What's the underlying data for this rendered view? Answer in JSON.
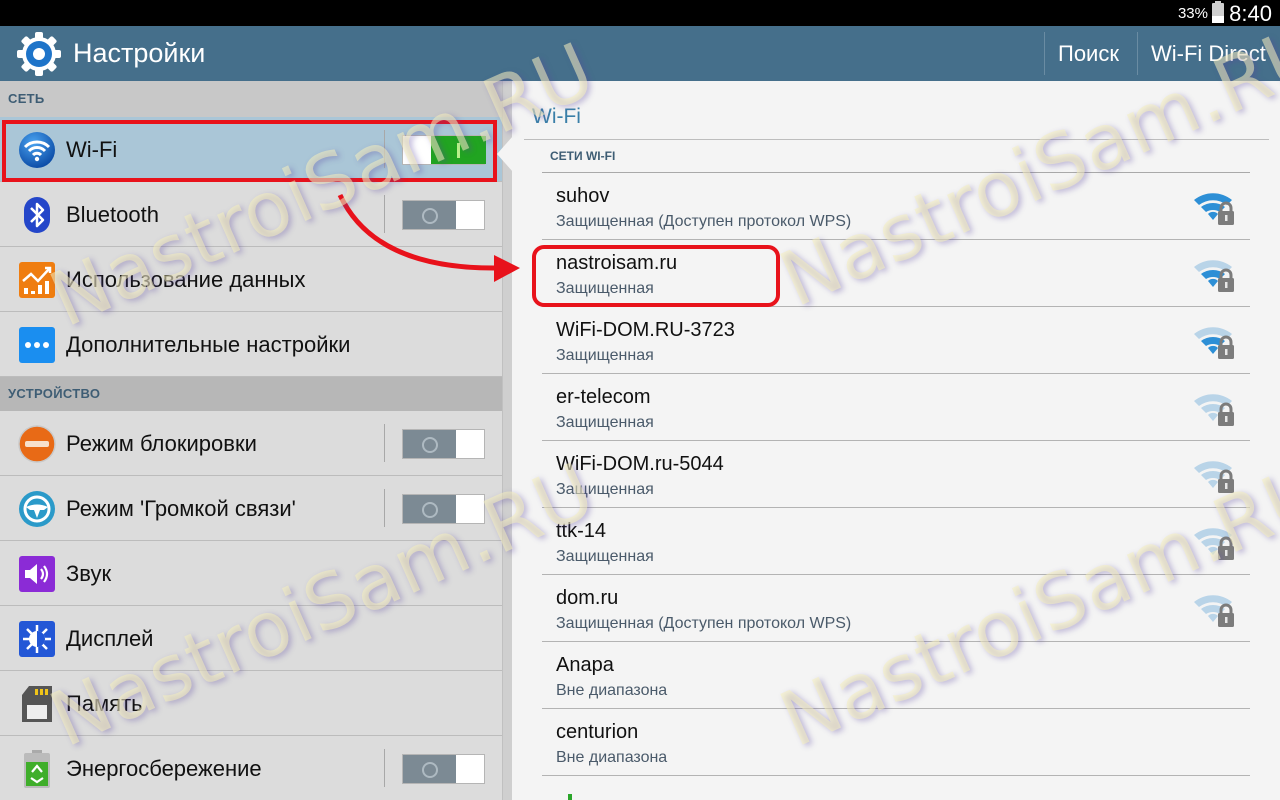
{
  "status_bar": {
    "battery_percent_label": "33%",
    "battery_level": 0.33,
    "time": "8:40"
  },
  "action_bar": {
    "title": "Настройки",
    "app_icon": "gear-icon",
    "buttons": [
      {
        "label": "Поиск"
      },
      {
        "label": "Wi-Fi Direct"
      }
    ]
  },
  "left_panel": {
    "categories": [
      {
        "label": "СЕТЬ",
        "items": [
          {
            "label": "Wi-Fi",
            "icon": "wifi-icon",
            "toggle": true,
            "state": "on",
            "selected": true
          },
          {
            "label": "Bluetooth",
            "icon": "bluetooth-icon",
            "toggle": true,
            "state": "off"
          },
          {
            "label": "Использование данных",
            "icon": "data-usage-icon",
            "toggle": false
          },
          {
            "label": "Дополнительные настройки",
            "icon": "more-settings-icon",
            "toggle": false
          }
        ]
      },
      {
        "label": "УСТРОЙСТВО",
        "items": [
          {
            "label": "Режим блокировки",
            "icon": "blocking-mode-icon",
            "toggle": true,
            "state": "off"
          },
          {
            "label": "Режим 'Громкой связи'",
            "icon": "driving-mode-icon",
            "toggle": true,
            "state": "off"
          },
          {
            "label": "Звук",
            "icon": "sound-icon",
            "toggle": false
          },
          {
            "label": "Дисплей",
            "icon": "display-icon",
            "toggle": false
          },
          {
            "label": "Память",
            "icon": "storage-icon",
            "toggle": false
          },
          {
            "label": "Энергосбережение",
            "icon": "power-saving-icon",
            "toggle": true,
            "state": "off"
          }
        ]
      }
    ]
  },
  "right_panel": {
    "title": "Wi-Fi",
    "section_label": "СЕТИ WI-FI",
    "networks": [
      {
        "ssid": "suhov",
        "status": "Защищенная (Доступен протокол WPS)",
        "signal_bars": 3,
        "secured": true
      },
      {
        "ssid": "nastroisam.ru",
        "status": "Защищенная",
        "signal_bars": 2,
        "secured": true,
        "highlighted": true
      },
      {
        "ssid": "WiFi-DOM.RU-3723",
        "status": "Защищенная",
        "signal_bars": 2,
        "secured": true
      },
      {
        "ssid": "er-telecom",
        "status": "Защищенная",
        "signal_bars": 0,
        "secured": true
      },
      {
        "ssid": "WiFi-DOM.ru-5044",
        "status": "Защищенная",
        "signal_bars": 0,
        "secured": true
      },
      {
        "ssid": "ttk-14",
        "status": "Защищенная",
        "signal_bars": 0,
        "secured": true
      },
      {
        "ssid": "dom.ru",
        "status": "Защищенная (Доступен протокол WPS)",
        "signal_bars": 0,
        "secured": true
      },
      {
        "ssid": "Anapa",
        "status": "Вне диапазона"
      },
      {
        "ssid": "centurion",
        "status": "Вне диапазона"
      }
    ]
  },
  "watermark": "NastroiSam.RU",
  "colors": {
    "action_bar": "#456f8b",
    "toggle_on": "#21a421",
    "toggle_off": "#7c8a94",
    "selected_row": "#aac6d7",
    "annotation_red": "#e8121b",
    "accent_blue": "#3a7fa8",
    "signal_strong": "#2d8fd6",
    "signal_weak": "#b9d4e8"
  }
}
